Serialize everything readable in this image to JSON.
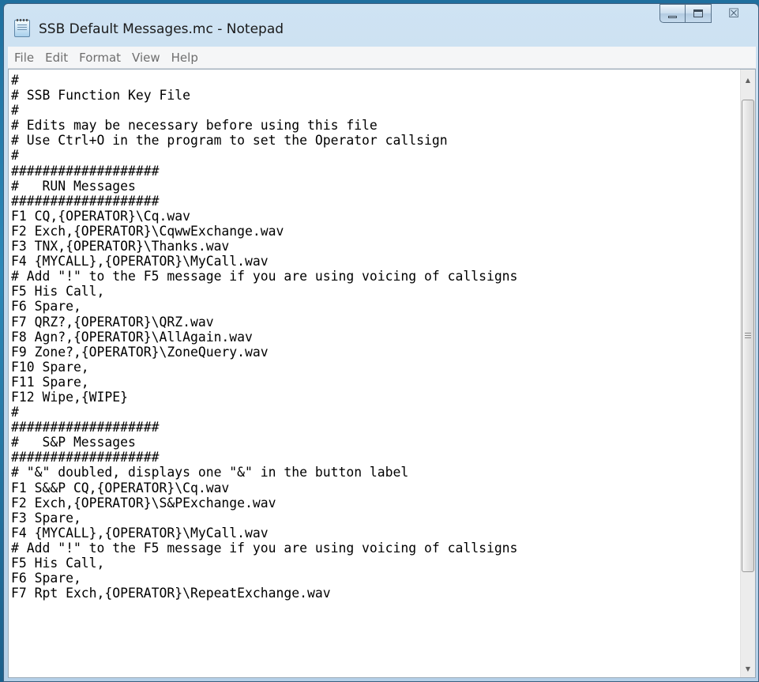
{
  "window": {
    "title": "SSB Default Messages.mc - Notepad",
    "close_glyph": "☒",
    "icons": {
      "app": "notepad-icon",
      "minimize": "minimize-icon",
      "maximize": "maximize-icon",
      "close": "close-icon"
    }
  },
  "menu": {
    "items": [
      {
        "label": "File"
      },
      {
        "label": "Edit"
      },
      {
        "label": "Format"
      },
      {
        "label": "View"
      },
      {
        "label": "Help"
      }
    ]
  },
  "editor": {
    "lines": [
      "#",
      "# SSB Function Key File",
      "#",
      "# Edits may be necessary before using this file",
      "# Use Ctrl+O in the program to set the Operator callsign",
      "#",
      "###################",
      "#   RUN Messages",
      "###################",
      "F1 CQ,{OPERATOR}\\Cq.wav",
      "F2 Exch,{OPERATOR}\\CqwwExchange.wav",
      "F3 TNX,{OPERATOR}\\Thanks.wav",
      "F4 {MYCALL},{OPERATOR}\\MyCall.wav",
      "# Add \"!\" to the F5 message if you are using voicing of callsigns",
      "F5 His Call,",
      "F6 Spare,",
      "F7 QRZ?,{OPERATOR}\\QRZ.wav",
      "F8 Agn?,{OPERATOR}\\AllAgain.wav",
      "F9 Zone?,{OPERATOR}\\ZoneQuery.wav",
      "F10 Spare,",
      "F11 Spare,",
      "F12 Wipe,{WIPE}",
      "#",
      "###################",
      "#   S&P Messages",
      "###################",
      "# \"&\" doubled, displays one \"&\" in the button label",
      "F1 S&&P CQ,{OPERATOR}\\Cq.wav",
      "F2 Exch,{OPERATOR}\\S&PExchange.wav",
      "F3 Spare,",
      "F4 {MYCALL},{OPERATOR}\\MyCall.wav",
      "# Add \"!\" to the F5 message if you are using voicing of callsigns",
      "F5 His Call,",
      "F6 Spare,",
      "F7 Rpt Exch,{OPERATOR}\\RepeatExchange.wav"
    ]
  },
  "scrollbar": {
    "up_glyph": "▲",
    "down_glyph": "▼",
    "position": 0.0
  }
}
